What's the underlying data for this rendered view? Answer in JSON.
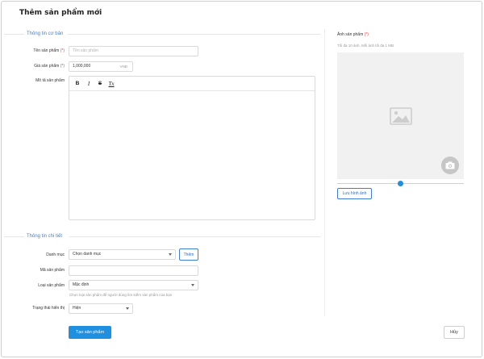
{
  "page": {
    "title": "Thêm sản phẩm mới"
  },
  "basic": {
    "section_title": "Thông tin cơ bản",
    "name": {
      "label": "Tên sản phẩm",
      "required": "(*)",
      "placeholder": "Tên sản phẩm"
    },
    "price": {
      "label": "Giá sản phẩm",
      "required": "(*)",
      "value": "1,000,000",
      "unit": "VNĐ"
    },
    "description": {
      "label": "Mô tả sản phẩm"
    }
  },
  "editor": {
    "bold": "B",
    "italic": "I",
    "strike": "S",
    "clear": "Tx"
  },
  "image": {
    "label": "Ảnh sản phẩm",
    "required": "(*)",
    "hint": "Tối đa 10 ảnh. Mỗi ảnh tối đa 1 MB",
    "save_label": "Lưu hình ảnh",
    "slider_value": 0.5
  },
  "detail": {
    "section_title": "Thông tin chi tiết",
    "category": {
      "label": "Danh mục",
      "value": "Chọn danh mục",
      "add_label": "Thêm"
    },
    "code": {
      "label": "Mã sản phẩm",
      "value": ""
    },
    "type": {
      "label": "Loại sản phẩm",
      "value": "Mặc định",
      "hint": "Chọn loại sản phẩm để người dùng tìm kiếm sản phẩm của bạn"
    },
    "status": {
      "label": "Trạng thái hiển thị",
      "value": "Hiện"
    }
  },
  "actions": {
    "submit_label": "Tạo sản phẩm",
    "cancel_label": "Hủy"
  },
  "colors": {
    "accent": "#1f8fe0",
    "section": "#4a7fc6",
    "required": "#e04848"
  },
  "icons": [
    "bold-icon",
    "italic-icon",
    "strikethrough-icon",
    "clear-format-icon",
    "image-placeholder-icon",
    "camera-icon",
    "chevron-down-icon"
  ]
}
